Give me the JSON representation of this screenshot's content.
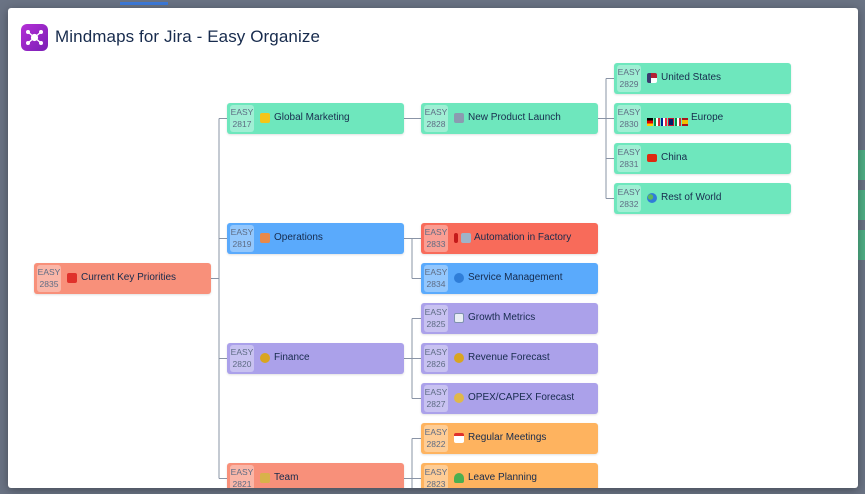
{
  "app": {
    "title": "Mindmaps for Jira - Easy Organize"
  },
  "colors": {
    "coral": "#f8907a",
    "red": "#f86b5a",
    "green": "#6ee7bd",
    "blue": "#5aaafc",
    "purple": "#aba1ea",
    "orange": "#feb35f",
    "connector": "#8a94a6"
  },
  "nodes": {
    "n2835": {
      "project": "EASY",
      "number": "2835",
      "label": "Current Key Priorities",
      "icon": "hundred-points-icon"
    },
    "n2817": {
      "project": "EASY",
      "number": "2817",
      "label": "Global Marketing",
      "icon": "raised-hands-icon"
    },
    "n2819": {
      "project": "EASY",
      "number": "2819",
      "label": "Operations",
      "icon": "factory-icon"
    },
    "n2820": {
      "project": "EASY",
      "number": "2820",
      "label": "Finance",
      "icon": "money-bag-icon"
    },
    "n2821": {
      "project": "EASY",
      "number": "2821",
      "label": "Team",
      "icon": "team-icon"
    },
    "n2828": {
      "project": "EASY",
      "number": "2828",
      "label": "New Product Launch",
      "icon": "rocket-icon"
    },
    "n2833": {
      "project": "EASY",
      "number": "2833",
      "label": "Automation in Factory",
      "icon": "exclamation-robot-icon"
    },
    "n2834": {
      "project": "EASY",
      "number": "2834",
      "label": "Service Management",
      "icon": "globe-icon"
    },
    "n2825": {
      "project": "EASY",
      "number": "2825",
      "label": "Growth Metrics",
      "icon": "chart-icon"
    },
    "n2826": {
      "project": "EASY",
      "number": "2826",
      "label": "Revenue Forecast",
      "icon": "money-bag-icon"
    },
    "n2827": {
      "project": "EASY",
      "number": "2827",
      "label": "OPEX/CAPEX Forecast",
      "icon": "coins-icon"
    },
    "n2822": {
      "project": "EASY",
      "number": "2822",
      "label": "Regular Meetings",
      "icon": "calendar-icon"
    },
    "n2823": {
      "project": "EASY",
      "number": "2823",
      "label": "Leave Planning",
      "icon": "beach-icon"
    },
    "n2829": {
      "project": "EASY",
      "number": "2829",
      "label": "United States",
      "icon": "us-flag-icon"
    },
    "n2830": {
      "project": "EASY",
      "number": "2830",
      "label": "Europe",
      "icon": "eu-flags-icon"
    },
    "n2831": {
      "project": "EASY",
      "number": "2831",
      "label": "China",
      "icon": "china-flag-icon"
    },
    "n2832": {
      "project": "EASY",
      "number": "2832",
      "label": "Rest of World",
      "icon": "earth-icon"
    }
  }
}
